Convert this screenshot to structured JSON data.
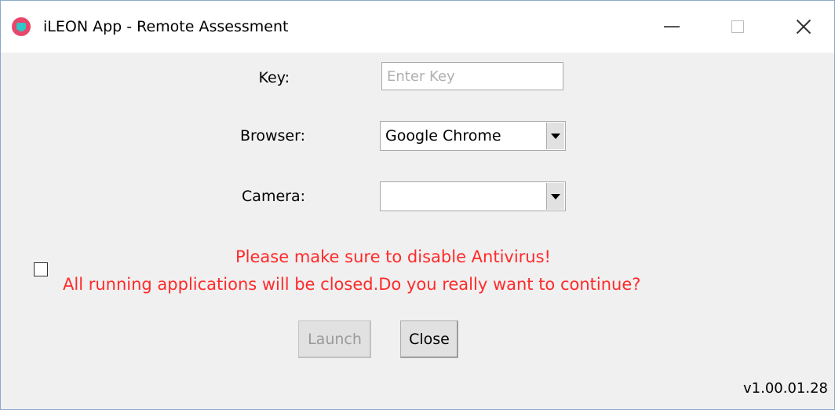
{
  "window": {
    "title": "iLEON App - Remote Assessment",
    "icon": "ileon-app-icon"
  },
  "form": {
    "key_label": "Key:",
    "key_placeholder": "Enter Key",
    "key_value": "",
    "browser_label": "Browser:",
    "browser_selected": "Google Chrome",
    "camera_label": "Camera:",
    "camera_selected": ""
  },
  "warning": {
    "checked": false,
    "line1": "Please make sure to disable Antivirus!",
    "line2": "All running applications will be closed.Do you really want to continue?",
    "color": "#ff2a2a"
  },
  "buttons": {
    "launch": "Launch",
    "launch_enabled": false,
    "close": "Close"
  },
  "version": "v1.00.01.28"
}
